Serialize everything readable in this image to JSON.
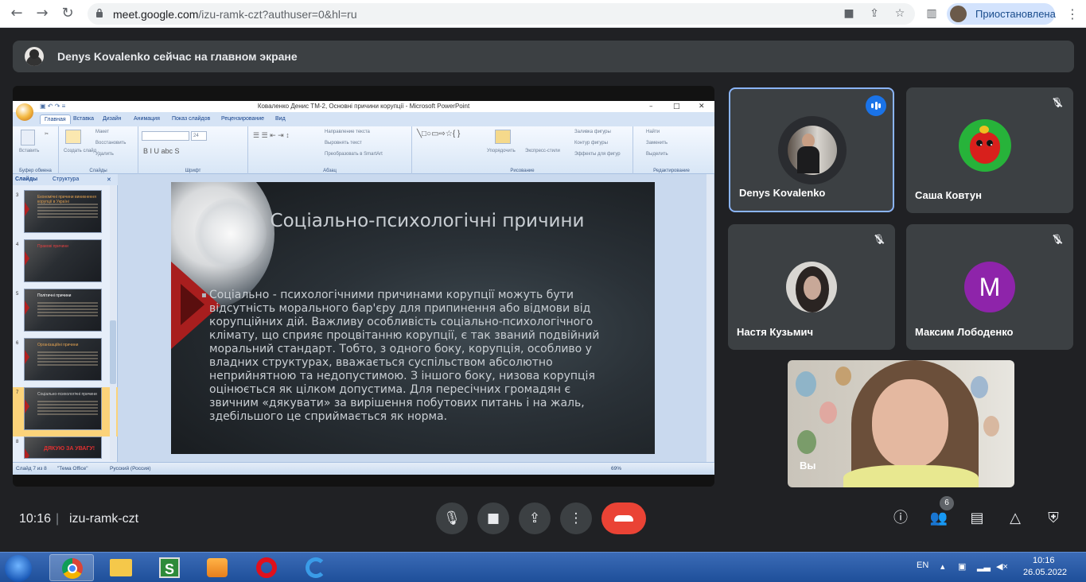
{
  "browser": {
    "url_host": "meet.google.com",
    "url_path": "/izu-ramk-czt?authuser=0&hl=ru",
    "profile_label": "Приостановлена"
  },
  "banner": {
    "text": "Denys Kovalenko сейчас на главном экране"
  },
  "powerpoint": {
    "window_title": "Коваленко Денис ТМ-2, Основні причини корупції - Microsoft PowerPoint",
    "tabs": [
      "Главная",
      "Вставка",
      "Дизайн",
      "Анимация",
      "Показ слайдов",
      "Рецензирование",
      "Вид"
    ],
    "groups": [
      "Буфер обмена",
      "Слайды",
      "Шрифт",
      "Абзац",
      "Рисование",
      "Редактирование"
    ],
    "ribbon": {
      "paste": "Вставить",
      "create_slide": "Создать слайд",
      "layout": "Макет",
      "restore": "Восстановить",
      "delete": "Удалить",
      "font_size": "24",
      "text_direction": "Направление текста",
      "align_text": "Выровнять текст",
      "smartart": "Преобразовать в SmartArt",
      "arrange": "Упорядочить",
      "quick_styles": "Экспресс-стили",
      "shape_fill": "Заливка фигуры",
      "shape_outline": "Контур фигуры",
      "shape_effects": "Эффекты для фигур",
      "find": "Найти",
      "replace": "Заменить",
      "select": "Выделить"
    },
    "side_tabs": [
      "Слайды",
      "Структура"
    ],
    "thumbnails": [
      {
        "num": "3",
        "title": "Економічні причини виникнення корупції в Україні"
      },
      {
        "num": "4",
        "title": "Правові причини"
      },
      {
        "num": "5",
        "title": "Політичні причини"
      },
      {
        "num": "6",
        "title": "Організаційні причини"
      },
      {
        "num": "7",
        "title": "Соціально-психологічні причини"
      },
      {
        "num": "8",
        "title": "ДЯКУЮ ЗА УВАГУ!"
      }
    ],
    "slide": {
      "title": "Соціально-психологічні причини",
      "body": "Соціально - психологічними причинами корупції можуть бути відсутність морального бар'єру для припинення або відмови від корупційних дій. Важливу особливість соціально-психологічного клімату, що сприяє процвітанню корупції, є так званий подвійний моральний стандарт. Тобто, з одного боку, корупція, особливо у владних структурах, вважається суспільством абсолютно неприйнятною та недопустимою. З іншого боку, низова корупція оцінюється як цілком допустима. Для пересічних громадян є звичним «дякувати» за вирішення побутових питань і на жаль, здебільшого це сприймається як норма."
    },
    "status": {
      "slide_counter": "Слайд 7 из 8",
      "theme": "\"Тема Office\"",
      "language": "Русский (Россия)",
      "zoom": "69%"
    }
  },
  "participants": [
    {
      "name": "Denys Kovalenko",
      "speaking": true
    },
    {
      "name": "Саша Ковтун",
      "muted": true
    },
    {
      "name": "Настя Кузьмич",
      "muted": true
    },
    {
      "name": "Максим Лободенко",
      "muted": true,
      "initial": "M",
      "color": "#8e24aa"
    }
  ],
  "self_view": {
    "label": "Вы"
  },
  "meeting": {
    "time": "10:16",
    "code": "izu-ramk-czt",
    "people_count": "6"
  },
  "taskbar": {
    "lang": "EN",
    "time": "10:16",
    "date": "26.05.2022"
  },
  "icons": {
    "mic": "mic-icon",
    "camera": "camera-icon",
    "present": "present-icon",
    "more": "more-vert-icon",
    "end_call": "call-end-icon",
    "info": "info-icon",
    "people": "people-icon",
    "chat": "chat-icon",
    "activities": "activities-icon",
    "host_controls": "shield-lock-icon"
  }
}
